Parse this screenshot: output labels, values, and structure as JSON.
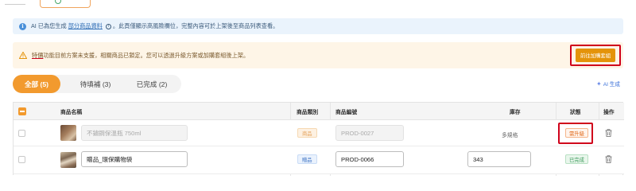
{
  "info_banner": {
    "icon": "info-icon",
    "prefix": "AI 已為您生成",
    "link": "部分商品資料",
    "suffix": "。此頁僅顯示高風險欄位，完整內容可於上架後至商品列表查看。"
  },
  "warning_banner": {
    "icon": "warning-icon",
    "highlight": "特價",
    "text": "功能目前方案未支援，相關商品已鎖定。您可以透過升級方案或加購套組後上架。",
    "button": "前往加購套組"
  },
  "status_tabs": [
    {
      "label": "全部 (5)",
      "active": true
    },
    {
      "label": "待填補 (3)",
      "active": false
    },
    {
      "label": "已完成 (2)",
      "active": false
    }
  ],
  "ai_generate": {
    "label": "AI 生成",
    "icon": "sparkle-icon"
  },
  "table": {
    "headers": {
      "name": "商品名稱",
      "category": "商品類別",
      "sku": "商品編號",
      "stock": "庫存",
      "status": "狀態",
      "actions": "操作"
    },
    "rows": [
      {
        "name": "不鏽鋼保溫瓶 750ml",
        "category": "商品",
        "sku": "PROD-0027",
        "stock": "多規格",
        "status": "需升級",
        "locked": true
      },
      {
        "name": "贈品_環保購物袋",
        "category": "贈品",
        "sku": "PROD-0066",
        "stock": "343",
        "status": "已完成",
        "locked": false
      }
    ]
  },
  "colors": {
    "accent": "#f29a2e",
    "info_bg": "#eaf3fc",
    "warning_bg": "#fef5e7",
    "highlight_frame": "#d0021b"
  }
}
